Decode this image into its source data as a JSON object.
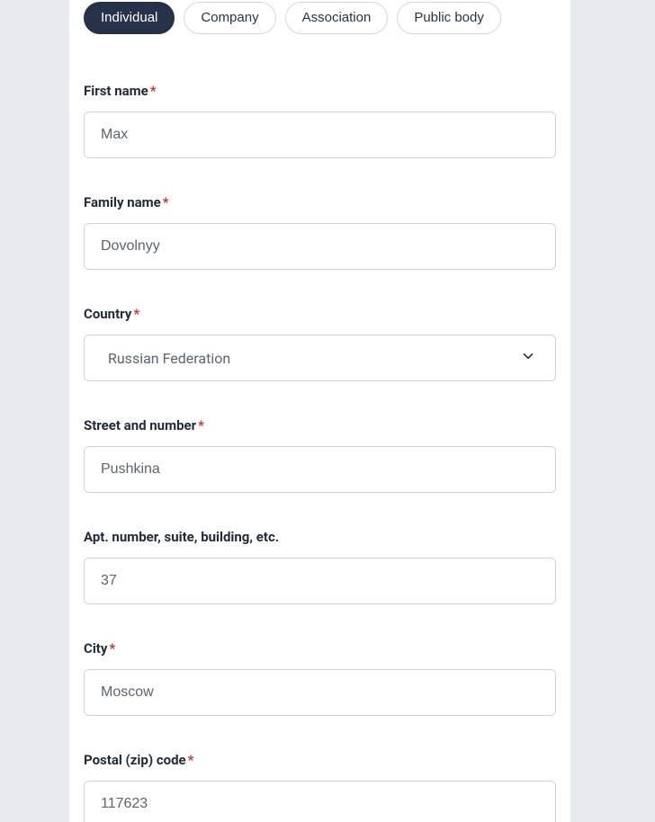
{
  "tabs": {
    "individual": "Individual",
    "company": "Company",
    "association": "Association",
    "public_body": "Public body"
  },
  "fields": {
    "first_name": {
      "label": "First name",
      "value": "Max",
      "required": true
    },
    "family_name": {
      "label": "Family name",
      "value": "Dovolnyy",
      "required": true
    },
    "country": {
      "label": "Country",
      "value": "Russian Federation",
      "required": true
    },
    "street": {
      "label": "Street and number",
      "value": "Pushkina",
      "required": true
    },
    "apt": {
      "label": "Apt. number, suite, building, etc.",
      "value": "37",
      "required": false
    },
    "city": {
      "label": "City",
      "value": "Moscow",
      "required": true
    },
    "postal": {
      "label": "Postal (zip) code",
      "value": "117623",
      "required": true
    }
  }
}
